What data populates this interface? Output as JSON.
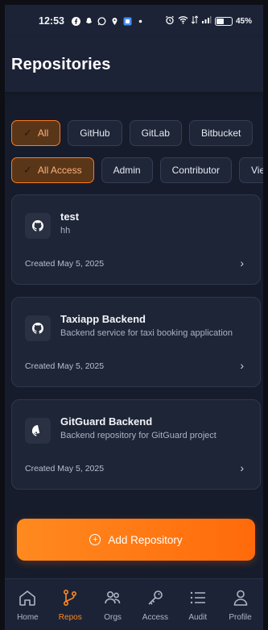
{
  "status": {
    "time": "12:53",
    "battery": "45%",
    "battery_level": 0.45,
    "notification_icons": [
      "facebook-icon",
      "snapchat-icon",
      "whatsapp-icon",
      "location-icon",
      "app-icon",
      "dot-icon"
    ],
    "system_icons": [
      "alarm-icon",
      "wifi-icon",
      "data-icon",
      "signal-icon"
    ]
  },
  "header": {
    "title": "Repositories"
  },
  "filters": {
    "platforms": [
      {
        "label": "All",
        "active": true
      },
      {
        "label": "GitHub",
        "active": false
      },
      {
        "label": "GitLab",
        "active": false
      },
      {
        "label": "Bitbucket",
        "active": false
      }
    ],
    "access": [
      {
        "label": "All Access",
        "active": true
      },
      {
        "label": "Admin",
        "active": false
      },
      {
        "label": "Contributor",
        "active": false
      },
      {
        "label": "Viewer",
        "active": false
      }
    ]
  },
  "repos": [
    {
      "name": "test",
      "description": "hh",
      "created": "Created May 5, 2025",
      "icon": "github-icon"
    },
    {
      "name": "Taxiapp Backend",
      "description": "Backend service for taxi booking application",
      "created": "Created May 5, 2025",
      "icon": "github-icon"
    },
    {
      "name": "GitGuard Backend",
      "description": "Backend repository for GitGuard project",
      "created": "Created May 5, 2025",
      "icon": "github-icon"
    }
  ],
  "add_button": {
    "label": "Add Repository"
  },
  "nav": [
    {
      "label": "Home",
      "icon": "home-icon",
      "active": false
    },
    {
      "label": "Repos",
      "icon": "branch-icon",
      "active": true
    },
    {
      "label": "Orgs",
      "icon": "users-icon",
      "active": false
    },
    {
      "label": "Access",
      "icon": "key-icon",
      "active": false
    },
    {
      "label": "Audit",
      "icon": "list-icon",
      "active": false
    },
    {
      "label": "Profile",
      "icon": "person-icon",
      "active": false
    }
  ],
  "colors": {
    "accent": "#ff7a1a",
    "background": "#161c2c",
    "card": "#1e2537"
  }
}
